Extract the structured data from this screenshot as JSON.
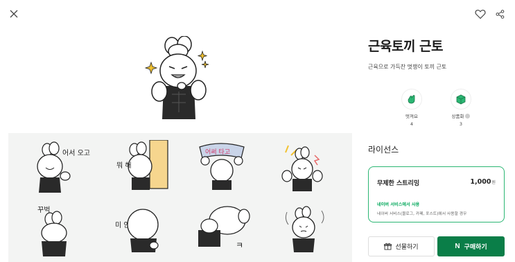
{
  "header": {
    "close_icon": "close-icon",
    "heart_icon": "heart-icon",
    "share_icon": "share-icon"
  },
  "product": {
    "title": "근육토끼 근토",
    "description": "근육으로 가득찬 멋쟁이 토끼 근토"
  },
  "stats": [
    {
      "label": "멋져요",
      "count": "4",
      "icon": "clap-icon"
    },
    {
      "label": "상품화",
      "count": "3",
      "icon": "box-icon"
    }
  ],
  "license": {
    "heading": "라이선스",
    "name": "무제한 스트리밍",
    "price": "1,000",
    "currency": "원",
    "usage": "네이버 서비스에서 사용",
    "detail": "네이버 서비스(블로그, 카페, 포스트)에서 사용할 경우"
  },
  "actions": {
    "gift_label": "선물하기",
    "buy_label": "구매하기",
    "buy_logo": "N"
  },
  "stickers": [
    {
      "text": "어서 오고"
    },
    {
      "text": "뭐 해"
    },
    {
      "text": "어써 타고"
    },
    {
      "text": ""
    },
    {
      "text": "꾸벅"
    },
    {
      "text": "미 안"
    },
    {
      "text": "ㅋ"
    },
    {
      "text": ""
    }
  ],
  "colors": {
    "accent": "#2bb673",
    "buy_button": "#0a7e48",
    "usage_text": "#03a85b",
    "preview_bg": "#f3f4f3"
  }
}
